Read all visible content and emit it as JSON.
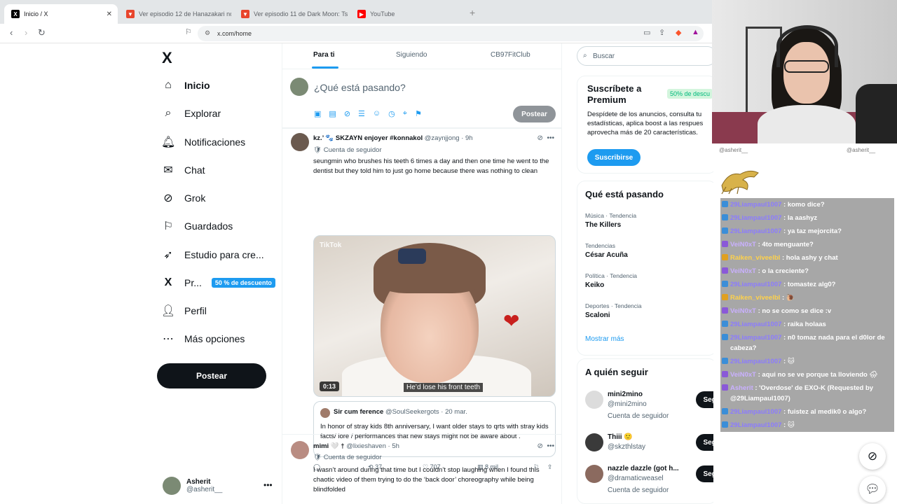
{
  "browser": {
    "tabs": [
      {
        "title": "Inicio / X",
        "favicon_color": "#000000"
      },
      {
        "title": "Ver episodio 12 de Hanazakari no Ki",
        "favicon_color": "#e8452c"
      },
      {
        "title": "Ver episodio 11 de Dark Moon: Tsuk",
        "favicon_color": "#e8452c"
      },
      {
        "title": "YouTube",
        "favicon_color": "#ff0000"
      }
    ],
    "url": "x.com/home",
    "new_tab": "+"
  },
  "nav": {
    "logo": "X",
    "items": [
      {
        "label": "Inicio",
        "icon": "home-icon",
        "glyph": "⌂"
      },
      {
        "label": "Explorar",
        "icon": "search-icon",
        "glyph": "⌕"
      },
      {
        "label": "Notificaciones",
        "icon": "bell-icon",
        "glyph": "♫"
      },
      {
        "label": "Chat",
        "icon": "mail-icon",
        "glyph": "✉"
      },
      {
        "label": "Grok",
        "icon": "grok-icon",
        "glyph": "⊘"
      },
      {
        "label": "Guardados",
        "icon": "bookmark-icon",
        "glyph": "⚐"
      },
      {
        "label": "Estudio para cre...",
        "icon": "rocket-icon",
        "glyph": "➶"
      },
      {
        "label": "Pr...",
        "icon": "x-premium-icon",
        "glyph": "X"
      },
      {
        "label": "Perfil",
        "icon": "person-icon",
        "glyph": "☺"
      },
      {
        "label": "Más opciones",
        "icon": "more-circle-icon",
        "glyph": "⋯"
      }
    ],
    "premium_badge": "50 % de descuento",
    "post_button": "Postear",
    "account": {
      "name": "Asherit",
      "handle": "@asherit__"
    }
  },
  "feed": {
    "tabs": [
      "Para ti",
      "Siguiendo",
      "CB97FitClub"
    ],
    "compose_placeholder": "¿Qué está pasando?",
    "compose_post": "Postear",
    "tweets": [
      {
        "name": "kz.’ 🐾 SKZAYN enjoyer #konnakol",
        "handle": "@zaynjjong",
        "time": "· 9h",
        "sub": "Cuenta de seguidor",
        "text": "seungmin who brushes his teeth 6 times a day and then one time he went to the dentist but they told him to just go home because there was nothing to clean",
        "video_watermark": "TikTok",
        "video_duration": "0:13",
        "video_caption": "He’d lose his front teeth",
        "quote": {
          "name": "Sir cum ference",
          "handle": "@SoulSeekergots",
          "time": "· 20 mar.",
          "text": "In honor of stray kids 8th anniversary, I want older stays to qrts with stray kids facts/ lore / performances that new stays might not be aware about ."
        },
        "retweets": "37",
        "likes": "707",
        "views": "8 mil"
      },
      {
        "name": "mimi 🤍 †",
        "handle": "@lixieshaven",
        "time": "· 5h",
        "sub": "Cuenta de seguidor",
        "text": "I wasn’t around during that time but I couldn’t stop laughing when I found this chaotic video of them trying to do the ‘back door’ choreography while being blindfolded"
      }
    ]
  },
  "right": {
    "search_placeholder": "Buscar",
    "premium": {
      "title": "Suscríbete a Premium",
      "badge": "50% de descu",
      "desc": "Despídete de los anuncios, consulta tu estadísticas, aplica boost a las respues aprovecha más de 20 características.",
      "button": "Suscribirse"
    },
    "trends_title": "Qué está pasando",
    "trends": [
      {
        "cat": "Música · Tendencia",
        "title": "The Killers"
      },
      {
        "cat": "Tendencias",
        "title": "César Acuña"
      },
      {
        "cat": "Política · Tendencia",
        "title": "Keiko"
      },
      {
        "cat": "Deportes · Tendencia",
        "title": "Scaloni"
      }
    ],
    "show_more": "Mostrar más",
    "follow_title": "A quién seguir",
    "follows": [
      {
        "name": "mini2mino",
        "handle": "@mini2mino",
        "sub": "Cuenta de seguidor",
        "button": "Seguir"
      },
      {
        "name": "Thiii 🙂",
        "handle": "@skzthlstay",
        "sub": "",
        "button": "Seguir"
      },
      {
        "name": "nazzle dazzle (got h...",
        "handle": "@dramaticweasel",
        "sub": "Cuenta de seguidor",
        "button": "Seguir"
      }
    ]
  },
  "chat": {
    "top_left": "@asherit__",
    "top_right": "@asherit__",
    "messages": [
      {
        "user": "29Liampaul1007",
        "text": ": komo dice?",
        "c": ""
      },
      {
        "user": "29Liampaul1007",
        "text": ": la aashyz",
        "c": ""
      },
      {
        "user": "29Liampaul1007",
        "text": ": ya taz mejorcita?",
        "c": ""
      },
      {
        "user": "VeiN0xT",
        "text": ": 4to menguante?",
        "c": "p"
      },
      {
        "user": "Raiken_viveelbl",
        "text": ": hola ashy y chat",
        "c": "y"
      },
      {
        "user": "VeiN0xT",
        "text": ": o la creciente?",
        "c": "p"
      },
      {
        "user": "29Liampaul1007",
        "text": ": tomastez alg0?",
        "c": ""
      },
      {
        "user": "Raiken_viveelbl",
        "text": ": 🐌",
        "c": "y"
      },
      {
        "user": "VeiN0xT",
        "text": ": no se como se dice :v",
        "c": "p"
      },
      {
        "user": "29Liampaul1007",
        "text": ": raika holaas",
        "c": ""
      },
      {
        "user": "29Liampaul1007",
        "text": ": n0 tomaz nada para el d0lor de cabeza?",
        "c": ""
      },
      {
        "user": "29Liampaul1007",
        "text": ": 🐱",
        "c": ""
      },
      {
        "user": "VeiN0xT",
        "text": ": aqui no se ve porque ta lloviendo 🌧",
        "c": "p"
      },
      {
        "user": "Asherit",
        "text": ": 'Overdose' de EXO-K (Requested by @29Liampaul1007)",
        "c": "p"
      },
      {
        "user": "29Liampaul1007",
        "text": ": fuistez al medik0 o algo?",
        "c": ""
      },
      {
        "user": "29Liampaul1007",
        "text": ": 🐱",
        "c": ""
      }
    ]
  }
}
